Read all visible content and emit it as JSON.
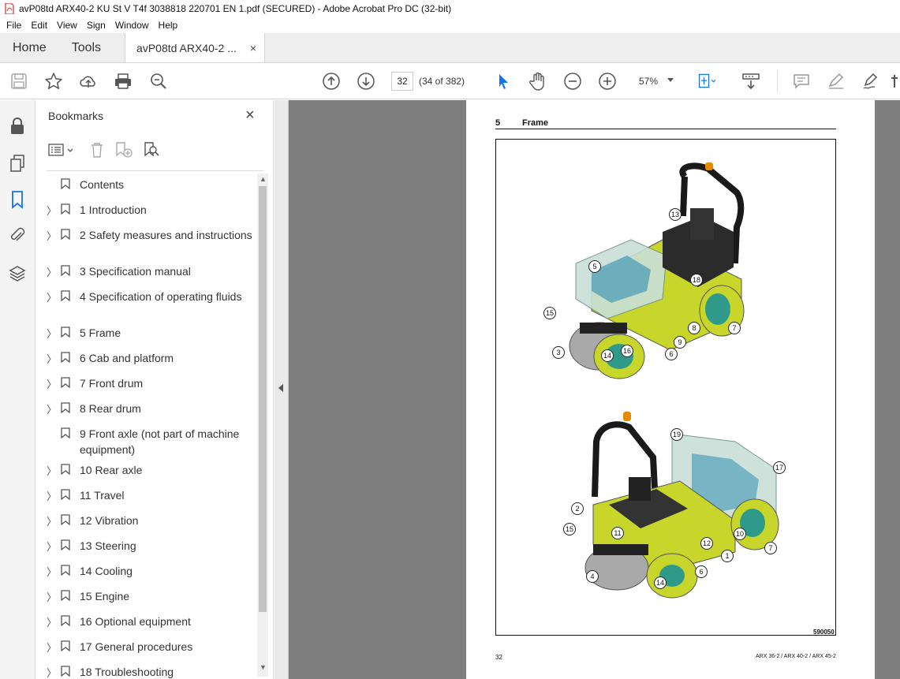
{
  "window": {
    "title": "avP08td ARX40-2 KU St V T4f 3038818 220701 EN 1.pdf (SECURED) - Adobe Acrobat Pro DC (32-bit)"
  },
  "menu": [
    "File",
    "Edit",
    "View",
    "Sign",
    "Window",
    "Help"
  ],
  "tabs": {
    "home": "Home",
    "tools": "Tools",
    "document": "avP08td ARX40-2 ...",
    "close": "×"
  },
  "toolbar": {
    "page_current": "32",
    "page_count": "(34 of 382)",
    "zoom": "57%"
  },
  "bookmarks_panel": {
    "title": "Bookmarks",
    "close": "×",
    "items": [
      {
        "label": "Contents",
        "expandable": false
      },
      {
        "label": "1 Introduction",
        "expandable": true
      },
      {
        "label": "2 Safety measures and instructions",
        "expandable": true
      },
      {
        "label": "3 Specification manual",
        "expandable": true
      },
      {
        "label": "4 Specification of operating fluids",
        "expandable": true
      },
      {
        "label": "5 Frame",
        "expandable": true
      },
      {
        "label": "6 Cab and platform",
        "expandable": true
      },
      {
        "label": "7 Front drum",
        "expandable": true
      },
      {
        "label": "8 Rear drum",
        "expandable": true
      },
      {
        "label": "9 Front axle (not part of machine equipment)",
        "expandable": false
      },
      {
        "label": "10 Rear axle",
        "expandable": true
      },
      {
        "label": "11 Travel",
        "expandable": true
      },
      {
        "label": "12 Vibration",
        "expandable": true
      },
      {
        "label": "13 Steering",
        "expandable": true
      },
      {
        "label": "14 Cooling",
        "expandable": true
      },
      {
        "label": "15 Engine",
        "expandable": true
      },
      {
        "label": "16 Optional equipment",
        "expandable": true
      },
      {
        "label": "17 General procedures",
        "expandable": true
      },
      {
        "label": "18 Troubleshooting",
        "expandable": true
      }
    ]
  },
  "document": {
    "section_number": "5",
    "section_title": "Frame",
    "figure_code": "590050",
    "page_number": "32",
    "footer_models": "ARX 36-2 / ARX 40-2 / ARX 45-2",
    "callouts_top": [
      "13",
      "5",
      "18",
      "15",
      "8",
      "7",
      "9",
      "6",
      "16",
      "3",
      "14"
    ],
    "callouts_bottom": [
      "19",
      "17",
      "2",
      "11",
      "15",
      "12",
      "10",
      "7",
      "1",
      "6",
      "4",
      "14"
    ]
  },
  "colors": {
    "machine_yellow": "#c8d62b",
    "drum_grey": "#a9a9a9",
    "teal": "#2f9a8a",
    "acrobat_red": "#d0312d",
    "icon_blue": "#1473e6"
  }
}
